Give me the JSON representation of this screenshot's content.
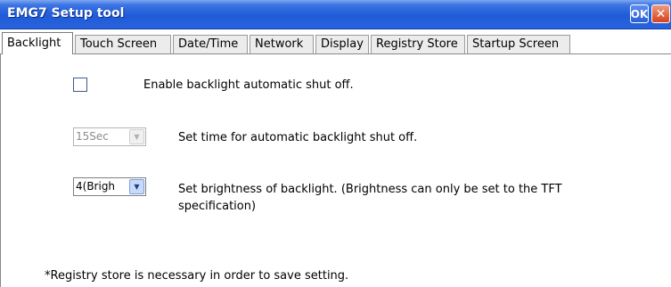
{
  "window": {
    "title": "EMG7 Setup tool",
    "ok_label": "OK",
    "close_label": "✕"
  },
  "tabs": [
    {
      "label": "Backlight",
      "active": true
    },
    {
      "label": "Touch Screen",
      "active": false
    },
    {
      "label": "Date/Time",
      "active": false
    },
    {
      "label": "Network",
      "active": false
    },
    {
      "label": "Display",
      "active": false
    },
    {
      "label": "Registry Store",
      "active": false
    },
    {
      "label": "Startup Screen",
      "active": false
    }
  ],
  "backlight": {
    "auto_shutoff": {
      "checked": false,
      "label": "Enable backlight automatic shut off."
    },
    "shutoff_time": {
      "value": "15Sec",
      "enabled": false,
      "label": "Set time for automatic backlight shut off."
    },
    "brightness": {
      "value": "4(Brigh",
      "enabled": true,
      "label_line1": "Set brightness of backlight. (Brightness can only be set to the TFT",
      "label_line2": "specification)"
    },
    "note": "*Registry store is necessary in order to save setting."
  },
  "icons": {
    "dropdown": "chevron-down-icon"
  }
}
